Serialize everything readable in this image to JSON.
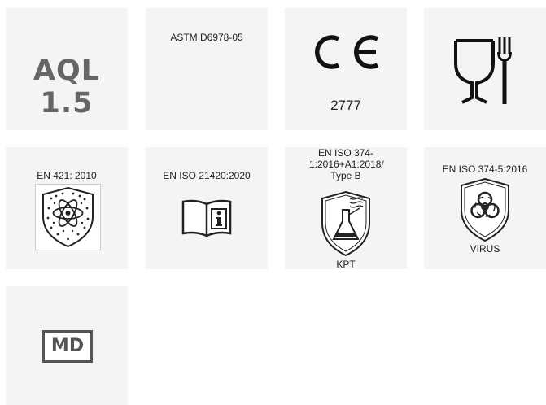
{
  "certifications": [
    {
      "text": "AQL 1.5",
      "icon": "aql-mark"
    },
    {
      "label": "ASTM D6978-05"
    },
    {
      "label": "2777",
      "icon": "ce-mark-icon"
    },
    {
      "icon": "food-safe-icon"
    },
    {
      "label": "EN 421: 2010",
      "icon": "radioactive-contamination-shield-icon"
    },
    {
      "label": "EN ISO 21420:2020",
      "icon": "information-book-icon"
    },
    {
      "label": "EN ISO 374-1:2016+A1:2018/ Type B",
      "caption": "KPT",
      "icon": "chemical-flask-shield-icon"
    },
    {
      "label": "EN ISO 374-5:2016",
      "caption": "VIRUS",
      "icon": "biohazard-shield-icon"
    },
    {
      "text": "MD",
      "icon": "medical-device-icon"
    }
  ],
  "colors": {
    "tile_background": "#f4f4f4",
    "icon_dark": "#222222",
    "icon_grey": "#666666"
  }
}
